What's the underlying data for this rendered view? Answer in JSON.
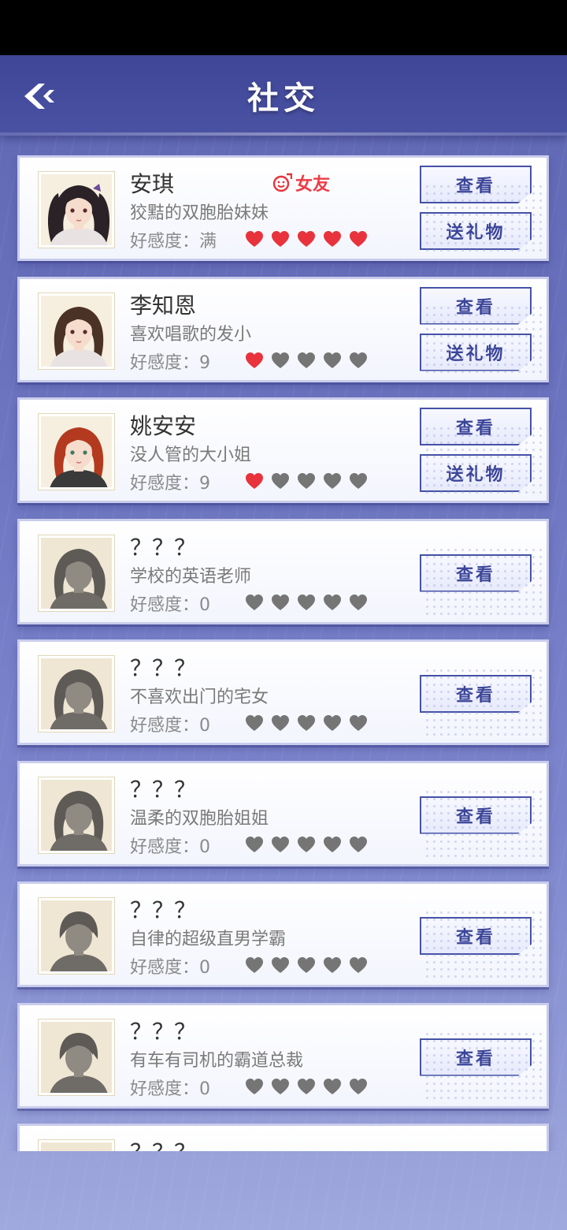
{
  "header": {
    "title": "社交"
  },
  "characters": [
    {
      "name": "安琪",
      "desc": "狡黠的双胞胎妹妹",
      "affinity_label": "好感度：满",
      "hearts_filled": 5,
      "relation": "女友",
      "buttons": [
        "查看",
        "送礼物"
      ],
      "avatar": "girl-black-twintails"
    },
    {
      "name": "李知恩",
      "desc": "喜欢唱歌的发小",
      "affinity_label": "好感度：9",
      "hearts_filled": 1,
      "buttons": [
        "查看",
        "送礼物"
      ],
      "avatar": "girl-brown-hair"
    },
    {
      "name": "姚安安",
      "desc": "没人管的大小姐",
      "affinity_label": "好感度：9",
      "hearts_filled": 1,
      "buttons": [
        "查看",
        "送礼物"
      ],
      "avatar": "girl-red-hair"
    },
    {
      "name": "？？？",
      "desc": "学校的英语老师",
      "affinity_label": "好感度：0",
      "hearts_filled": 0,
      "buttons": [
        "查看"
      ],
      "avatar": "locked-ponytail"
    },
    {
      "name": "？？？",
      "desc": "不喜欢出门的宅女",
      "affinity_label": "好感度：0",
      "hearts_filled": 0,
      "buttons": [
        "查看"
      ],
      "avatar": "locked-bob"
    },
    {
      "name": "？？？",
      "desc": "温柔的双胞胎姐姐",
      "affinity_label": "好感度：0",
      "hearts_filled": 0,
      "buttons": [
        "查看"
      ],
      "avatar": "locked-bob"
    },
    {
      "name": "？？？",
      "desc": "自律的超级直男学霸",
      "affinity_label": "好感度：0",
      "hearts_filled": 0,
      "buttons": [
        "查看"
      ],
      "avatar": "locked-short"
    },
    {
      "name": "？？？",
      "desc": "有车有司机的霸道总裁",
      "affinity_label": "好感度：0",
      "hearts_filled": 0,
      "buttons": [
        "查看"
      ],
      "avatar": "locked-man"
    },
    {
      "name": "？？？",
      "desc": "",
      "affinity_label": "",
      "hearts_filled": 0,
      "buttons": [],
      "avatar": "locked-partial"
    }
  ],
  "colors": {
    "heart_filled": "#e8333c",
    "heart_empty": "#757575",
    "accent": "#4652a6"
  }
}
